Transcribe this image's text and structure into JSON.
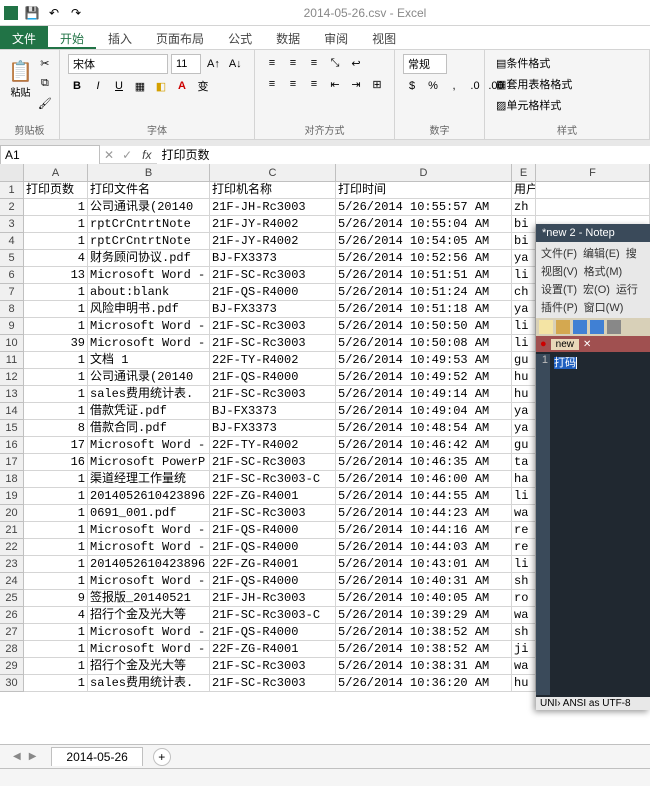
{
  "title": "2014-05-26.csv - Excel",
  "tabs": {
    "file": "文件",
    "t0": "开始",
    "t1": "插入",
    "t2": "页面布局",
    "t3": "公式",
    "t4": "数据",
    "t5": "审阅",
    "t6": "视图"
  },
  "clipboard": {
    "paste": "粘贴",
    "label": "剪贴板"
  },
  "font": {
    "name": "宋体",
    "size": "11",
    "label": "字体"
  },
  "align": {
    "label": "对齐方式"
  },
  "number": {
    "format": "常规",
    "label": "数字"
  },
  "styles": {
    "cond": "条件格式",
    "table": "套用表格格式",
    "cell": "单元格样式",
    "label": "样式"
  },
  "name_box": "A1",
  "formula": "打印页数",
  "cols": [
    "A",
    "B",
    "C",
    "D",
    "E",
    "F"
  ],
  "headers": {
    "a": "打印页数",
    "b": "打印文件名",
    "c": "打印机名称",
    "d": "打印时间",
    "e": "用户名"
  },
  "rows": [
    {
      "n": "1",
      "b": "公司通讯录(20140",
      "c": "21F-JH-Rc3003",
      "d": "5/26/2014 10:55:57 AM",
      "e": "zh"
    },
    {
      "n": "1",
      "b": "rptCrCntrtNote",
      "c": "21F-JY-R4002",
      "d": "5/26/2014 10:55:04 AM",
      "e": "bi"
    },
    {
      "n": "1",
      "b": "rptCrCntrtNote",
      "c": "21F-JY-R4002",
      "d": "5/26/2014 10:54:05 AM",
      "e": "bi"
    },
    {
      "n": "4",
      "b": "财务顾问协议.pdf",
      "c": "BJ-FX3373",
      "d": "5/26/2014 10:52:56 AM",
      "e": "ya"
    },
    {
      "n": "13",
      "b": "Microsoft Word -",
      "c": "21F-SC-Rc3003",
      "d": "5/26/2014 10:51:51 AM",
      "e": "li"
    },
    {
      "n": "1",
      "b": "about:blank",
      "c": "21F-QS-R4000",
      "d": "5/26/2014 10:51:24 AM",
      "e": "ch"
    },
    {
      "n": "1",
      "b": "风险申明书.pdf",
      "c": "BJ-FX3373",
      "d": "5/26/2014 10:51:18 AM",
      "e": "ya"
    },
    {
      "n": "1",
      "b": "Microsoft Word -",
      "c": "21F-SC-Rc3003",
      "d": "5/26/2014 10:50:50 AM",
      "e": "li"
    },
    {
      "n": "39",
      "b": "Microsoft Word -",
      "c": "21F-SC-Rc3003",
      "d": "5/26/2014 10:50:08 AM",
      "e": "li"
    },
    {
      "n": "1",
      "b": "文档 1",
      "c": "22F-TY-R4002",
      "d": "5/26/2014 10:49:53 AM",
      "e": "gu"
    },
    {
      "n": "1",
      "b": "公司通讯录(20140",
      "c": "21F-QS-R4000",
      "d": "5/26/2014 10:49:52 AM",
      "e": "hu"
    },
    {
      "n": "1",
      "b": "sales费用统计表.",
      "c": "21F-SC-Rc3003",
      "d": "5/26/2014 10:49:14 AM",
      "e": "hu"
    },
    {
      "n": "1",
      "b": "借款凭证.pdf",
      "c": "BJ-FX3373",
      "d": "5/26/2014 10:49:04 AM",
      "e": "ya"
    },
    {
      "n": "8",
      "b": "借款合同.pdf",
      "c": "BJ-FX3373",
      "d": "5/26/2014 10:48:54 AM",
      "e": "ya"
    },
    {
      "n": "17",
      "b": "Microsoft Word -",
      "c": "22F-TY-R4002",
      "d": "5/26/2014 10:46:42 AM",
      "e": "gu"
    },
    {
      "n": "16",
      "b": "Microsoft PowerP",
      "c": "21F-SC-Rc3003",
      "d": "5/26/2014 10:46:35 AM",
      "e": "ta"
    },
    {
      "n": "1",
      "b": "渠道经理工作量统",
      "c": "21F-SC-Rc3003-C",
      "d": "5/26/2014 10:46:00 AM",
      "e": "ha"
    },
    {
      "n": "1",
      "b": "2014052610423896",
      "c": "22F-ZG-R4001",
      "d": "5/26/2014 10:44:55 AM",
      "e": "li"
    },
    {
      "n": "1",
      "b": "0691_001.pdf",
      "c": "21F-SC-Rc3003",
      "d": "5/26/2014 10:44:23 AM",
      "e": "wa"
    },
    {
      "n": "1",
      "b": "Microsoft Word -",
      "c": "21F-QS-R4000",
      "d": "5/26/2014 10:44:16 AM",
      "e": "re"
    },
    {
      "n": "1",
      "b": "Microsoft Word -",
      "c": "21F-QS-R4000",
      "d": "5/26/2014 10:44:03 AM",
      "e": "re"
    },
    {
      "n": "1",
      "b": "2014052610423896",
      "c": "22F-ZG-R4001",
      "d": "5/26/2014 10:43:01 AM",
      "e": "li"
    },
    {
      "n": "1",
      "b": "Microsoft Word -",
      "c": "21F-QS-R4000",
      "d": "5/26/2014 10:40:31 AM",
      "e": "sh"
    },
    {
      "n": "9",
      "b": "签报版_20140521",
      "c": "21F-JH-Rc3003",
      "d": "5/26/2014 10:40:05 AM",
      "e": "ro"
    },
    {
      "n": "4",
      "b": "招行个金及光大等",
      "c": "21F-SC-Rc3003-C",
      "d": "5/26/2014 10:39:29 AM",
      "e": "wa"
    },
    {
      "n": "1",
      "b": "Microsoft Word -",
      "c": "21F-QS-R4000",
      "d": "5/26/2014 10:38:52 AM",
      "e": "sh"
    },
    {
      "n": "1",
      "b": "Microsoft Word -",
      "c": "22F-ZG-R4001",
      "d": "5/26/2014 10:38:52 AM",
      "e": "ji"
    },
    {
      "n": "1",
      "b": "招行个金及光大等",
      "c": "21F-SC-Rc3003",
      "d": "5/26/2014 10:38:31 AM",
      "e": "wa"
    },
    {
      "n": "1",
      "b": "sales费用统计表.",
      "c": "21F-SC-Rc3003",
      "d": "5/26/2014 10:36:20 AM",
      "e": "hu"
    }
  ],
  "sheet_name": "2014-05-26",
  "notepad": {
    "title": "*new  2 - Notep",
    "menu": {
      "file": "文件(F)",
      "edit": "编辑(E)",
      "search": "搜",
      "view": "视图(V)",
      "fmt": "格式(M)",
      "set": "设置(T)",
      "macro": "宏(O)",
      "run": "运行",
      "plugin": "插件(P)",
      "window": "窗口(W)"
    },
    "tab": "new",
    "line_num": "1",
    "text": "打码",
    "status": "UNI› ANSI as UTF-8"
  }
}
